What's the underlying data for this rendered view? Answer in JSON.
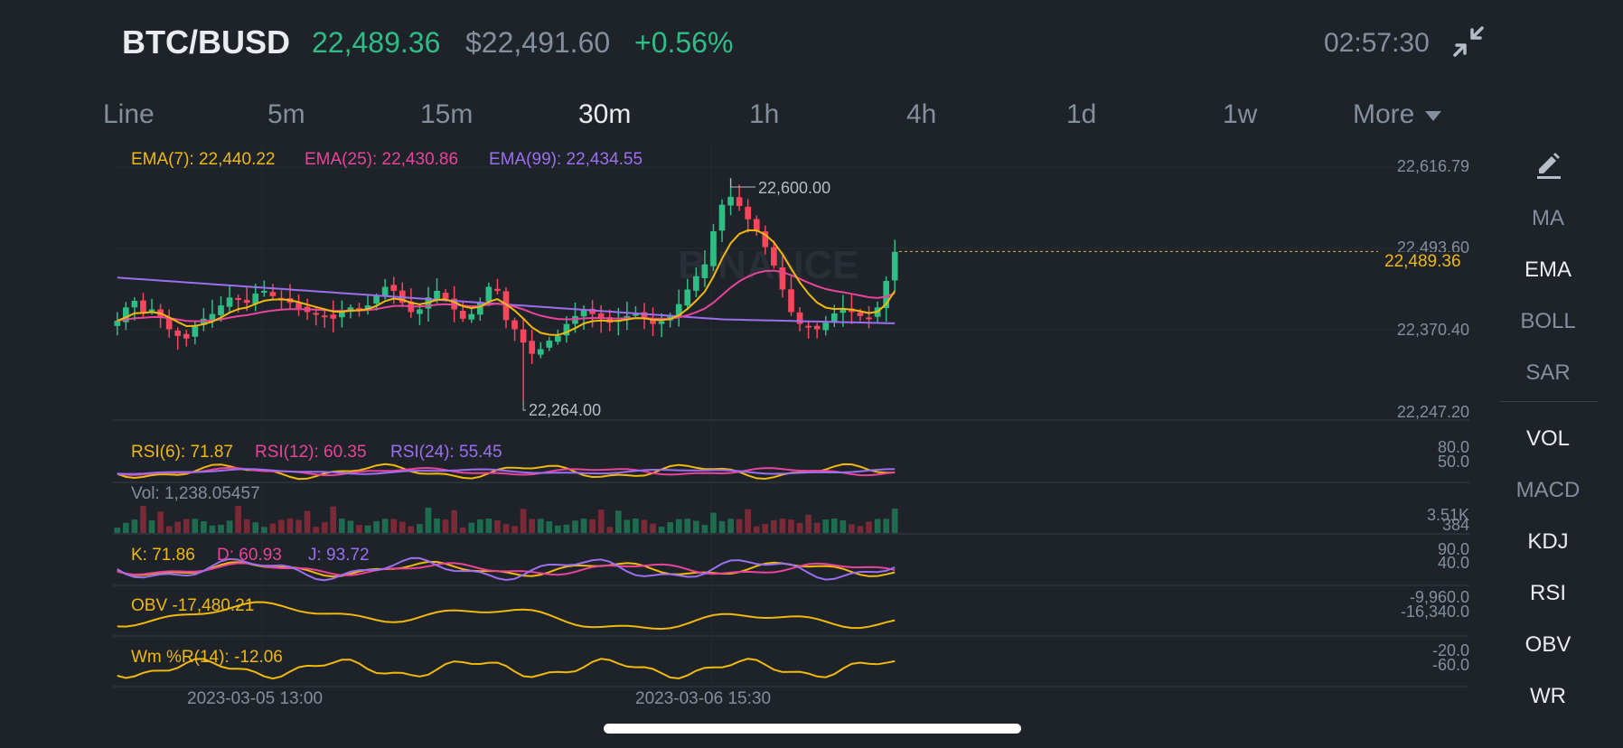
{
  "header": {
    "pair": "BTC/BUSD",
    "price": "22,489.36",
    "usd_price": "$22,491.60",
    "change": "+0.56%",
    "time": "02:57:30",
    "collapse_icon": "collapse-arrows-icon"
  },
  "timeframes": [
    "Line",
    "5m",
    "15m",
    "30m",
    "1h",
    "4h",
    "1d",
    "1w",
    "More"
  ],
  "active_timeframe": "30m",
  "sidebar": {
    "edit_icon": "pencil-icon",
    "main_indicators": [
      "MA",
      "EMA",
      "BOLL",
      "SAR"
    ],
    "sub_indicators": [
      "VOL",
      "MACD",
      "KDJ",
      "RSI",
      "OBV",
      "WR"
    ],
    "active": [
      "EMA",
      "VOL",
      "KDJ",
      "RSI",
      "OBV",
      "WR"
    ]
  },
  "ema_legend": {
    "ema7": "EMA(7): 22,440.22",
    "ema25": "EMA(25): 22,430.86",
    "ema99": "EMA(99): 22,434.55"
  },
  "price_axis": [
    "22,616.79",
    "22,493.60",
    "22,370.40",
    "22,247.20"
  ],
  "last_price_tag": "22,489.36",
  "annotations": {
    "high": "22,600.00",
    "low": "22,264.00"
  },
  "rsi": {
    "rsi6": "RSI(6): 71.87",
    "rsi12": "RSI(12): 60.35",
    "rsi24": "RSI(24): 55.45",
    "axis": [
      "80.0",
      "50.0"
    ]
  },
  "vol": {
    "label": "Vol: 1,238.05457",
    "axis": [
      "3.51K",
      "384"
    ]
  },
  "kdj": {
    "k": "K: 71.86",
    "d": "D: 60.93",
    "j": "J: 93.72",
    "axis": [
      "90.0",
      "40.0"
    ]
  },
  "obv": {
    "label": "OBV -17,480.21",
    "axis": [
      "-9,960.0",
      "-16,340.0"
    ]
  },
  "wr": {
    "label": "Wm %R(14): -12.06",
    "axis": [
      "-20.0",
      "-60.0"
    ]
  },
  "dates": [
    "2023-03-05 13:00",
    "2023-03-06 15:30"
  ],
  "watermark": "BINANCE",
  "colors": {
    "up": "#2ebd85",
    "down": "#f6465d",
    "ema7": "#f0b90b",
    "ema25": "#e8449a",
    "ema99": "#9b6ff0",
    "text_primary": "#eaecef",
    "text_secondary": "#848e9c",
    "background": "#1e2229"
  },
  "chart_data": {
    "type": "candlestick",
    "interval": "30m",
    "price_range": [
      22247.2,
      22616.79
    ],
    "high_label": 22600.0,
    "low_label": 22264.0,
    "last_price": 22489.36,
    "close_series": [
      22385,
      22405,
      22415,
      22398,
      22402,
      22390,
      22372,
      22362,
      22358,
      22378,
      22388,
      22395,
      22408,
      22420,
      22418,
      22412,
      22426,
      22430,
      22422,
      22418,
      22412,
      22404,
      22398,
      22395,
      22392,
      22388,
      22398,
      22405,
      22402,
      22408,
      22422,
      22436,
      22430,
      22412,
      22398,
      22402,
      22420,
      22430,
      22418,
      22402,
      22388,
      22395,
      22412,
      22436,
      22430,
      22386,
      22372,
      22352,
      22335,
      22342,
      22355,
      22362,
      22380,
      22392,
      22402,
      22395,
      22388,
      22382,
      22386,
      22392,
      22395,
      22388,
      22380,
      22384,
      22392,
      22410,
      22432,
      22452,
      22470,
      22520,
      22560,
      22572,
      22558,
      22538,
      22520,
      22496,
      22468,
      22432,
      22398,
      22380,
      22375,
      22372,
      22382,
      22396,
      22404,
      22398,
      22392,
      22388,
      22405,
      22445,
      22489
    ]
  }
}
